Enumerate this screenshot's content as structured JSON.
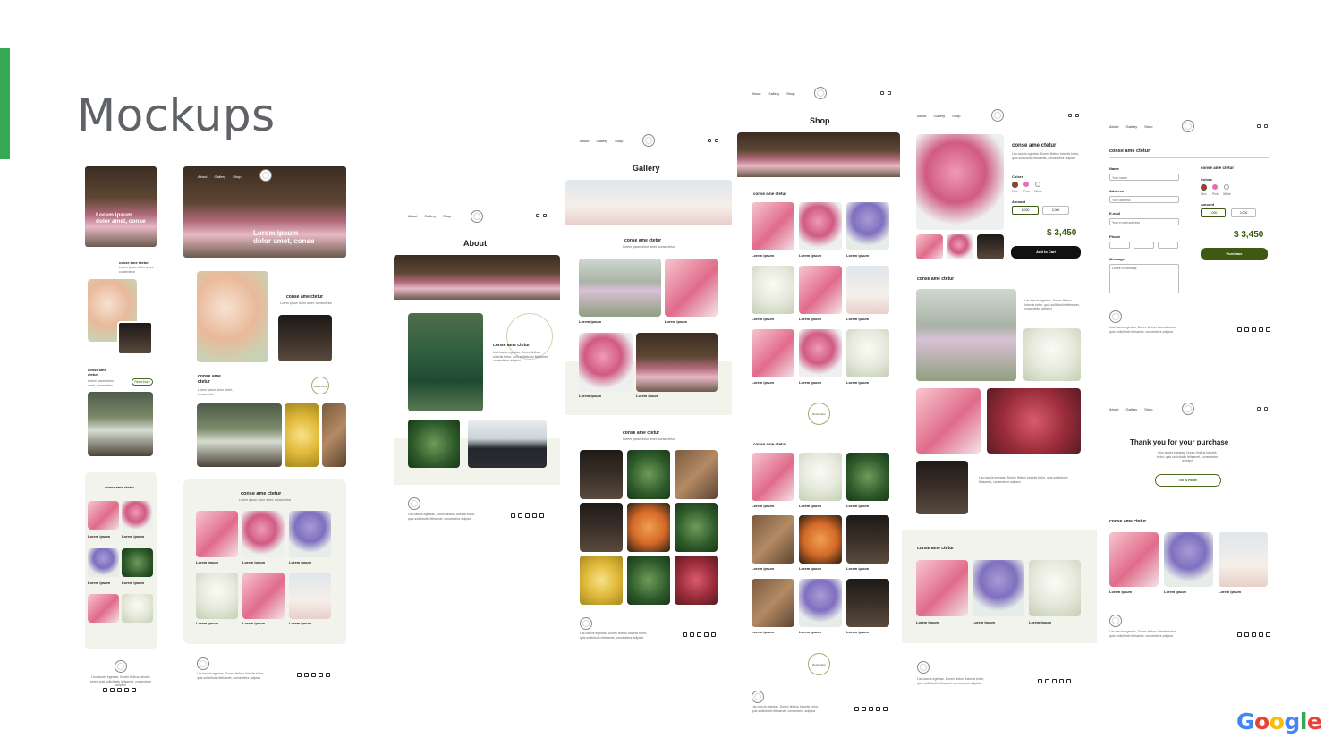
{
  "slide": {
    "title": "Mockups"
  },
  "brand": {
    "logo_text": "Google",
    "accent_color": "#34a853",
    "title_color": "#5f6368",
    "green": "#3e5a12"
  },
  "nav": {
    "about": "About",
    "gallery": "Gallery",
    "shop": "Shop"
  },
  "common": {
    "heading": "conse ame ctetur",
    "heading_split1": "conse ame",
    "heading_split2": "ctetur",
    "hero": "Lorem ipsum dolor amet, conse",
    "hero_l1": "Lorem ipsum",
    "hero_l2": "dolor amet, conse",
    "card_title": "Lorem ipsum",
    "card_sub": "Lorem ipsum dolor amet, consectetur",
    "read_more": "Read More",
    "footer_text": "Lisu taucis egestas. Donec finibus lobortis tortor, quis sollicitudin felisamet, consectetur adipisci"
  },
  "about": {
    "title": "About"
  },
  "gallery": {
    "title": "Gallery"
  },
  "shop": {
    "title": "Shop"
  },
  "product": {
    "colors_label": "Colors",
    "colors": [
      "Red",
      "Pink",
      "White"
    ],
    "amount_label": "Amount",
    "amounts": [
      "1,000",
      "2,000"
    ],
    "price": "$ 3,450",
    "add_to_cart": "Add to Cart"
  },
  "checkout": {
    "name_label": "Name",
    "address_label": "Address",
    "email_label": "E-mail",
    "phone_label": "Phone",
    "message_label": "Message",
    "name_ph": "Your name",
    "address_ph": "Your address",
    "email_ph": "Your e-mail address",
    "message_ph": "Leave a message",
    "purchase": "Purchase",
    "price": "$ 3,450"
  },
  "thanks": {
    "title": "Thank you for your purchase",
    "go_home": "Go to Home"
  }
}
